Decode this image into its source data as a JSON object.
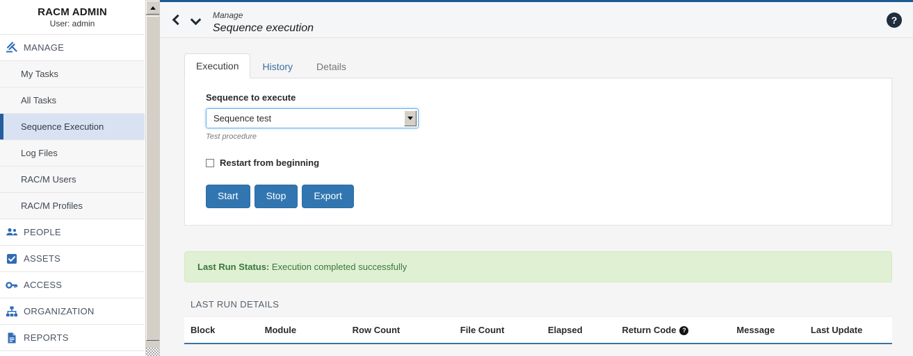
{
  "sidebar": {
    "brand": {
      "title": "RACM ADMIN",
      "user": "User: admin"
    },
    "groups": [
      {
        "label": "MANAGE",
        "icon": "gavel-icon",
        "items": [
          {
            "label": "My Tasks",
            "active": false
          },
          {
            "label": "All Tasks",
            "active": false
          },
          {
            "label": "Sequence Execution",
            "active": true
          },
          {
            "label": "Log Files",
            "active": false
          },
          {
            "label": "RAC/M Users",
            "active": false
          },
          {
            "label": "RAC/M Profiles",
            "active": false
          }
        ]
      },
      {
        "label": "PEOPLE",
        "icon": "people-icon",
        "items": []
      },
      {
        "label": "ASSETS",
        "icon": "clipboard-check-icon",
        "items": []
      },
      {
        "label": "ACCESS",
        "icon": "key-icon",
        "items": []
      },
      {
        "label": "ORGANIZATION",
        "icon": "org-chart-icon",
        "items": []
      },
      {
        "label": "REPORTS",
        "icon": "document-icon",
        "items": []
      }
    ]
  },
  "header": {
    "breadcrumb_parent": "Manage",
    "page_title": "Sequence execution",
    "back_icon": "chevron-left-icon",
    "dropdown_icon": "chevron-down-icon",
    "help_icon": "help-circle-icon",
    "help_glyph": "?"
  },
  "tabs": [
    {
      "label": "Execution",
      "state": "active"
    },
    {
      "label": "History",
      "state": "link"
    },
    {
      "label": "Details",
      "state": "muted"
    }
  ],
  "form": {
    "select_label": "Sequence to execute",
    "select_value": "Sequence test",
    "select_hint": "Test procedure",
    "checkbox_label": "Restart from beginning",
    "checkbox_checked": false,
    "buttons": [
      {
        "label": "Start",
        "name": "start-button"
      },
      {
        "label": "Stop",
        "name": "stop-button"
      },
      {
        "label": "Export",
        "name": "export-button"
      }
    ]
  },
  "status": {
    "label": "Last Run Status:",
    "message": "Execution completed successfully",
    "variant": "success",
    "bg": "#dff0d3",
    "fg": "#3c763d"
  },
  "last_run": {
    "section_title": "LAST RUN DETAILS",
    "columns": [
      {
        "label": "Block",
        "help": false
      },
      {
        "label": "Module",
        "help": false
      },
      {
        "label": "Row Count",
        "help": false
      },
      {
        "label": "File Count",
        "help": false
      },
      {
        "label": "Elapsed",
        "help": false
      },
      {
        "label": "Return Code",
        "help": true
      },
      {
        "label": "Message",
        "help": false
      },
      {
        "label": "Last Update",
        "help": false
      }
    ],
    "rows": []
  },
  "colors": {
    "accent_blue": "#1c5a94",
    "button_blue": "#3176b0",
    "active_nav_bg": "#d9e2f3",
    "focus_blue": "#66afe9"
  },
  "scrollbar": {
    "up_arrow_icon": "scroll-up-arrow-icon"
  }
}
